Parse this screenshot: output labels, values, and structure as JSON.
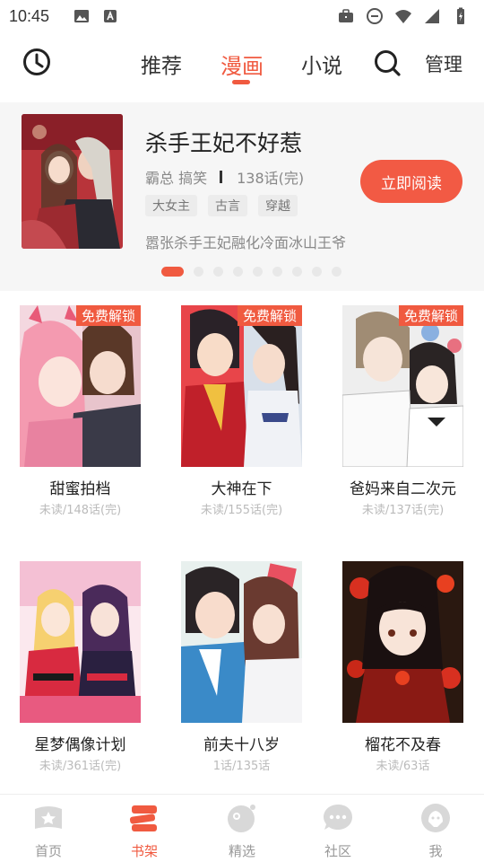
{
  "status_bar": {
    "time": "10:45"
  },
  "top_nav": {
    "tabs": [
      {
        "label": "推荐"
      },
      {
        "label": "漫画"
      },
      {
        "label": "小说"
      }
    ],
    "active_tab": "漫画",
    "manage_label": "管理"
  },
  "banner": {
    "title": "杀手王妃不好惹",
    "genre": "霸总 搞笑",
    "chapters": "138话(完)",
    "tags": [
      "大女主",
      "古言",
      "穿越"
    ],
    "description": "嚣张杀手王妃融化冷面冰山王爷",
    "read_button": "立即阅读",
    "carousel_total": 9,
    "carousel_active": 0
  },
  "comics": [
    {
      "title": "甜蜜拍档",
      "progress": "未读/148话(完)",
      "badge": "免费解锁"
    },
    {
      "title": "大神在下",
      "progress": "未读/155话(完)",
      "badge": "免费解锁"
    },
    {
      "title": "爸妈来自二次元",
      "progress": "未读/137话(完)",
      "badge": "免费解锁"
    },
    {
      "title": "星梦偶像计划",
      "progress": "未读/361话(完)",
      "badge": ""
    },
    {
      "title": "前夫十八岁",
      "progress": "1话/135话",
      "badge": ""
    },
    {
      "title": "榴花不及春",
      "progress": "未读/63话",
      "badge": ""
    }
  ],
  "bottom_nav": [
    {
      "label": "首页",
      "icon": "home-icon"
    },
    {
      "label": "书架",
      "icon": "bookshelf-icon"
    },
    {
      "label": "精选",
      "icon": "featured-icon"
    },
    {
      "label": "社区",
      "icon": "community-icon"
    },
    {
      "label": "我",
      "icon": "profile-icon"
    }
  ],
  "colors": {
    "accent": "#f05a40",
    "muted": "#999999"
  }
}
